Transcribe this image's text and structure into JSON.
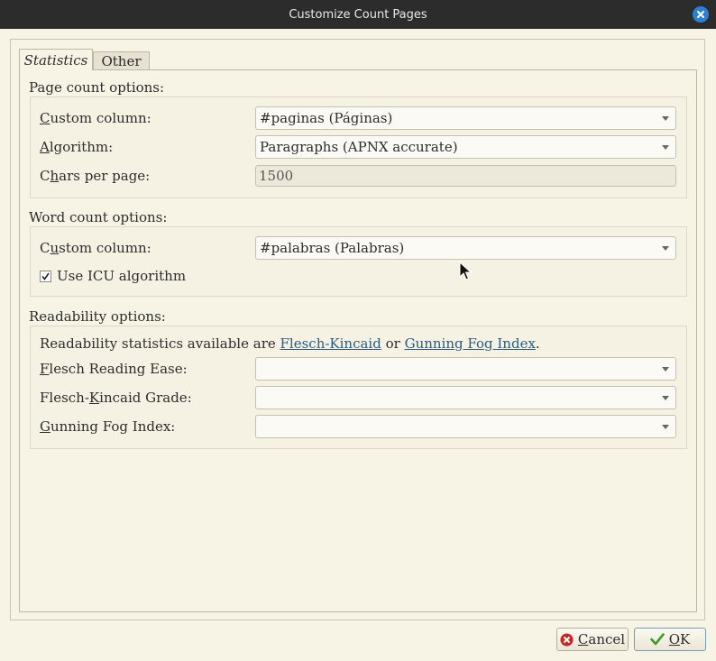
{
  "window": {
    "title": "Customize Count Pages"
  },
  "tabs": [
    {
      "label": "Statistics",
      "active": true
    },
    {
      "label": "Other",
      "active": false
    }
  ],
  "page_count": {
    "section_title": "Page count options:",
    "custom_column": {
      "label_u": "C",
      "label_rest": "ustom column:",
      "value": "#paginas (Páginas)"
    },
    "algorithm": {
      "label_u": "A",
      "label_rest": "lgorithm:",
      "value": "Paragraphs (APNX accurate)"
    },
    "chars_per_page": {
      "label_pre": "C",
      "label_u": "h",
      "label_rest": "ars per page:",
      "value": "1500"
    }
  },
  "word_count": {
    "section_title": "Word count options:",
    "custom_column": {
      "label_pre": "C",
      "label_u": "u",
      "label_rest": "stom column:",
      "value": "#palabras (Palabras)"
    },
    "icu": {
      "label": "Use ICU algorithm",
      "checked": true
    }
  },
  "readability": {
    "section_title": "Readability options:",
    "intro_pre": "Readability statistics available are ",
    "link1": "Flesch-Kincaid",
    "intro_mid": " or ",
    "link2": "Gunning Fog Index",
    "intro_post": ".",
    "flesch_ease": {
      "label_u": "F",
      "label_rest": "lesch Reading Ease:",
      "value": ""
    },
    "flesch_grade": {
      "label_pre": "Flesch-",
      "label_u": "K",
      "label_rest": "incaid Grade:",
      "value": ""
    },
    "gunning": {
      "label_u": "G",
      "label_rest": "unning Fog Index:",
      "value": ""
    }
  },
  "buttons": {
    "cancel": {
      "label_u": "C",
      "label_rest": "ancel"
    },
    "ok": {
      "label_u": "O",
      "label_rest": "K"
    }
  },
  "colors": {
    "titlebar": "#2c2c2c",
    "background": "#f7f3e5",
    "close_button": "#2d7fd3",
    "link": "#2a5d7f"
  },
  "icons": {
    "close": "close-icon",
    "cancel": "cancel-icon",
    "ok": "check-icon",
    "cursor": "mouse-pointer-icon"
  }
}
